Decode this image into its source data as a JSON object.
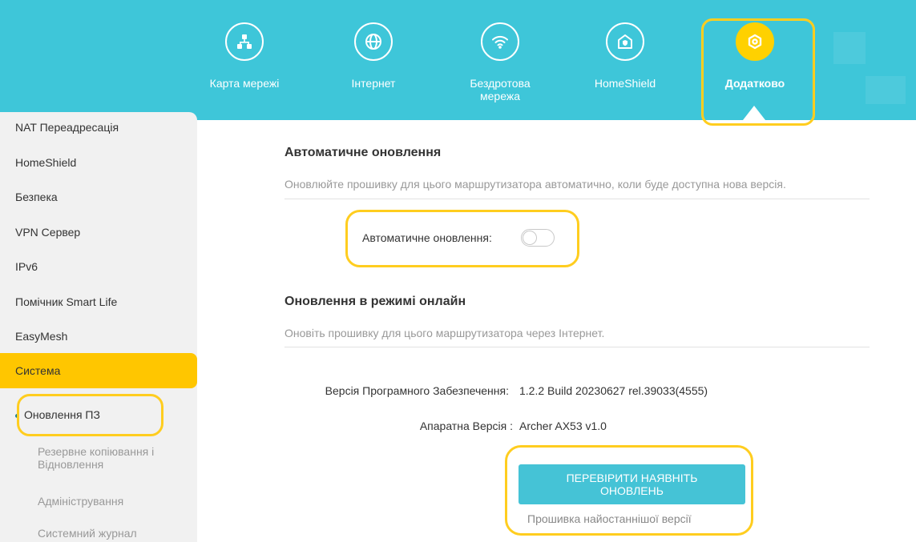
{
  "nav": {
    "items": [
      {
        "label": "Карта мережі",
        "icon": "network-map-icon"
      },
      {
        "label": "Інтернет",
        "icon": "globe-icon"
      },
      {
        "label": "Бездротова мережа",
        "icon": "wifi-icon"
      },
      {
        "label": "HomeShield",
        "icon": "home-shield-icon"
      },
      {
        "label": "Додатково",
        "icon": "gear-icon",
        "active": true
      }
    ]
  },
  "sidebar": {
    "items": [
      {
        "label": "NAT Переадресація"
      },
      {
        "label": "HomeShield"
      },
      {
        "label": "Безпека"
      },
      {
        "label": "VPN Сервер"
      },
      {
        "label": "IPv6"
      },
      {
        "label": "Помічник Smart Life"
      },
      {
        "label": "EasyMesh"
      },
      {
        "label": "Система",
        "active": true
      }
    ],
    "subitems": [
      {
        "label": "Оновлення ПЗ",
        "current": true
      },
      {
        "label": "Резервне копіювання і Відновлення"
      },
      {
        "label": "Адміністрування"
      },
      {
        "label": "Системний журнал"
      }
    ]
  },
  "auto_update": {
    "title": "Автоматичне оновлення",
    "description": "Оновлюйте прошивку для цього маршрутизатора автоматично, коли буде доступна нова версія.",
    "toggle_label": "Автоматичне оновлення:",
    "enabled": false
  },
  "online_update": {
    "title": "Оновлення в режимі онлайн",
    "description": "Оновіть прошивку для цього маршрутизатора через Інтернет.",
    "firmware_label": "Версія Програмного Забезпечення:",
    "firmware_value": "1.2.2 Build 20230627 rel.39033(4555)",
    "hardware_label": "Апаратна Версія :",
    "hardware_value": "Archer AX53 v1.0",
    "check_button": "ПЕРЕВІРИТИ НАЯВНІТЬ ОНОВЛЕНЬ",
    "status": "Прошивка найостаннішої версії"
  },
  "colors": {
    "header_bg": "#3ec6d9",
    "accent_yellow": "#ffc600",
    "highlight_frame": "#ffcd1f",
    "button_bg": "#45c3d6"
  }
}
